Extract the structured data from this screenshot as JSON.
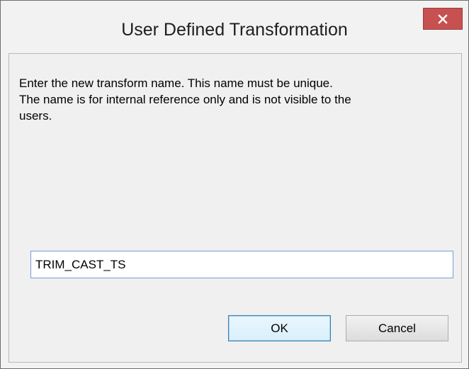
{
  "dialog": {
    "title": "User Defined Transformation",
    "close_icon": "close-icon",
    "message": "Enter the new transform name. This name must be unique.\nThe name is for internal reference only and is not visible to the\nusers.",
    "name_input": {
      "value": "TRIM_CAST_TS"
    },
    "buttons": {
      "ok_label": "OK",
      "cancel_label": "Cancel"
    }
  },
  "colors": {
    "close_button": "#c75050",
    "window_background": "#f0f0f0",
    "input_border": "#7a9cd3"
  }
}
